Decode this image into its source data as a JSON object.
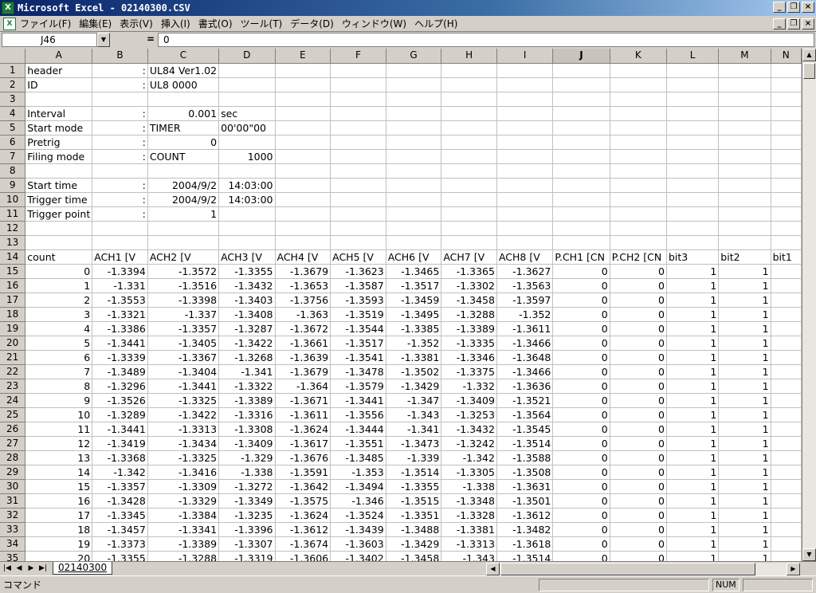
{
  "window": {
    "title": "Microsoft Excel - 02140300.CSV",
    "app_icon": "X",
    "min": "_",
    "restore": "❐",
    "close": "×"
  },
  "menu": [
    "ファイル(F)",
    "編集(E)",
    "表示(V)",
    "挿入(I)",
    "書式(O)",
    "ツール(T)",
    "データ(D)",
    "ウィンドウ(W)",
    "ヘルプ(H)"
  ],
  "formula": {
    "name_box": "J46",
    "equals": "=",
    "value": "0"
  },
  "columns": [
    "A",
    "B",
    "C",
    "D",
    "E",
    "F",
    "G",
    "H",
    "I",
    "J",
    "K",
    "L",
    "M",
    "N"
  ],
  "selected_column": "J",
  "rows": [
    [
      "1",
      "header",
      ":",
      "UL84  Ver1.02",
      "",
      "",
      "",
      "",
      "",
      "",
      "",
      "",
      "",
      "",
      ""
    ],
    [
      "2",
      "ID",
      ":",
      "UL8 0000",
      "",
      "",
      "",
      "",
      "",
      "",
      "",
      "",
      "",
      "",
      ""
    ],
    [
      "3",
      "",
      "",
      "",
      "",
      "",
      "",
      "",
      "",
      "",
      "",
      "",
      "",
      "",
      ""
    ],
    [
      "4",
      "Interval",
      ":",
      "0.001",
      "sec",
      "",
      "",
      "",
      "",
      "",
      "",
      "",
      "",
      "",
      ""
    ],
    [
      "5",
      "Start mode",
      ":",
      "TIMER",
      "00'00\"00",
      "",
      "",
      "",
      "",
      "",
      "",
      "",
      "",
      "",
      ""
    ],
    [
      "6",
      "Pretrig",
      ":",
      "0",
      "",
      "",
      "",
      "",
      "",
      "",
      "",
      "",
      "",
      "",
      ""
    ],
    [
      "7",
      "Filing mode",
      ":",
      "COUNT",
      "1000",
      "",
      "",
      "",
      "",
      "",
      "",
      "",
      "",
      "",
      ""
    ],
    [
      "8",
      "",
      "",
      "",
      "",
      "",
      "",
      "",
      "",
      "",
      "",
      "",
      "",
      "",
      ""
    ],
    [
      "9",
      "Start time",
      ":",
      "2004/9/2",
      "14:03:00",
      "",
      "",
      "",
      "",
      "",
      "",
      "",
      "",
      "",
      ""
    ],
    [
      "10",
      "Trigger time",
      ":",
      "2004/9/2",
      "14:03:00",
      "",
      "",
      "",
      "",
      "",
      "",
      "",
      "",
      "",
      ""
    ],
    [
      "11",
      "Trigger point",
      ":",
      "1",
      "",
      "",
      "",
      "",
      "",
      "",
      "",
      "",
      "",
      "",
      ""
    ],
    [
      "12",
      "",
      "",
      "",
      "",
      "",
      "",
      "",
      "",
      "",
      "",
      "",
      "",
      "",
      ""
    ],
    [
      "13",
      "",
      "",
      "",
      "",
      "",
      "",
      "",
      "",
      "",
      "",
      "",
      "",
      "",
      ""
    ],
    [
      "14",
      "count",
      "ACH1 [V",
      "ACH2 [V",
      "ACH3 [V",
      "ACH4 [V",
      "ACH5 [V",
      "ACH6 [V",
      "ACH7 [V",
      "ACH8 [V",
      "P.CH1 [CN",
      "P.CH2 [CN",
      "bit3",
      "bit2",
      "bit1"
    ],
    [
      "15",
      "0",
      "-1.3394",
      "-1.3572",
      "-1.3355",
      "-1.3679",
      "-1.3623",
      "-1.3465",
      "-1.3365",
      "-1.3627",
      "0",
      "0",
      "1",
      "1",
      ""
    ],
    [
      "16",
      "1",
      "-1.331",
      "-1.3516",
      "-1.3432",
      "-1.3653",
      "-1.3587",
      "-1.3517",
      "-1.3302",
      "-1.3563",
      "0",
      "0",
      "1",
      "1",
      ""
    ],
    [
      "17",
      "2",
      "-1.3553",
      "-1.3398",
      "-1.3403",
      "-1.3756",
      "-1.3593",
      "-1.3459",
      "-1.3458",
      "-1.3597",
      "0",
      "0",
      "1",
      "1",
      ""
    ],
    [
      "18",
      "3",
      "-1.3321",
      "-1.337",
      "-1.3408",
      "-1.363",
      "-1.3519",
      "-1.3495",
      "-1.3288",
      "-1.352",
      "0",
      "0",
      "1",
      "1",
      ""
    ],
    [
      "19",
      "4",
      "-1.3386",
      "-1.3357",
      "-1.3287",
      "-1.3672",
      "-1.3544",
      "-1.3385",
      "-1.3389",
      "-1.3611",
      "0",
      "0",
      "1",
      "1",
      ""
    ],
    [
      "20",
      "5",
      "-1.3441",
      "-1.3405",
      "-1.3422",
      "-1.3661",
      "-1.3517",
      "-1.352",
      "-1.3335",
      "-1.3466",
      "0",
      "0",
      "1",
      "1",
      ""
    ],
    [
      "21",
      "6",
      "-1.3339",
      "-1.3367",
      "-1.3268",
      "-1.3639",
      "-1.3541",
      "-1.3381",
      "-1.3346",
      "-1.3648",
      "0",
      "0",
      "1",
      "1",
      ""
    ],
    [
      "22",
      "7",
      "-1.3489",
      "-1.3404",
      "-1.341",
      "-1.3679",
      "-1.3478",
      "-1.3502",
      "-1.3375",
      "-1.3466",
      "0",
      "0",
      "1",
      "1",
      ""
    ],
    [
      "23",
      "8",
      "-1.3296",
      "-1.3441",
      "-1.3322",
      "-1.364",
      "-1.3579",
      "-1.3429",
      "-1.332",
      "-1.3636",
      "0",
      "0",
      "1",
      "1",
      ""
    ],
    [
      "24",
      "9",
      "-1.3526",
      "-1.3325",
      "-1.3389",
      "-1.3671",
      "-1.3441",
      "-1.347",
      "-1.3409",
      "-1.3521",
      "0",
      "0",
      "1",
      "1",
      ""
    ],
    [
      "25",
      "10",
      "-1.3289",
      "-1.3422",
      "-1.3316",
      "-1.3611",
      "-1.3556",
      "-1.343",
      "-1.3253",
      "-1.3564",
      "0",
      "0",
      "1",
      "1",
      ""
    ],
    [
      "26",
      "11",
      "-1.3441",
      "-1.3313",
      "-1.3308",
      "-1.3624",
      "-1.3444",
      "-1.341",
      "-1.3432",
      "-1.3545",
      "0",
      "0",
      "1",
      "1",
      ""
    ],
    [
      "27",
      "12",
      "-1.3419",
      "-1.3434",
      "-1.3409",
      "-1.3617",
      "-1.3551",
      "-1.3473",
      "-1.3242",
      "-1.3514",
      "0",
      "0",
      "1",
      "1",
      ""
    ],
    [
      "28",
      "13",
      "-1.3368",
      "-1.3325",
      "-1.329",
      "-1.3676",
      "-1.3485",
      "-1.339",
      "-1.342",
      "-1.3588",
      "0",
      "0",
      "1",
      "1",
      ""
    ],
    [
      "29",
      "14",
      "-1.342",
      "-1.3416",
      "-1.338",
      "-1.3591",
      "-1.353",
      "-1.3514",
      "-1.3305",
      "-1.3508",
      "0",
      "0",
      "1",
      "1",
      ""
    ],
    [
      "30",
      "15",
      "-1.3357",
      "-1.3309",
      "-1.3272",
      "-1.3642",
      "-1.3494",
      "-1.3355",
      "-1.338",
      "-1.3631",
      "0",
      "0",
      "1",
      "1",
      ""
    ],
    [
      "31",
      "16",
      "-1.3428",
      "-1.3329",
      "-1.3349",
      "-1.3575",
      "-1.346",
      "-1.3515",
      "-1.3348",
      "-1.3501",
      "0",
      "0",
      "1",
      "1",
      ""
    ],
    [
      "32",
      "17",
      "-1.3345",
      "-1.3384",
      "-1.3235",
      "-1.3624",
      "-1.3524",
      "-1.3351",
      "-1.3328",
      "-1.3612",
      "0",
      "0",
      "1",
      "1",
      ""
    ],
    [
      "33",
      "18",
      "-1.3457",
      "-1.3341",
      "-1.3396",
      "-1.3612",
      "-1.3439",
      "-1.3488",
      "-1.3381",
      "-1.3482",
      "0",
      "0",
      "1",
      "1",
      ""
    ],
    [
      "34",
      "19",
      "-1.3373",
      "-1.3389",
      "-1.3307",
      "-1.3674",
      "-1.3603",
      "-1.3429",
      "-1.3313",
      "-1.3618",
      "0",
      "0",
      "1",
      "1",
      ""
    ],
    [
      "35",
      "20",
      "-1.3355",
      "-1.3288",
      "-1.3319",
      "-1.3606",
      "-1.3402",
      "-1.3458",
      "-1.343",
      "-1.3514",
      "0",
      "0",
      "1",
      "1",
      ""
    ]
  ],
  "sheet_tab": "02140300",
  "tab_nav": [
    "|◀",
    "◀",
    "▶",
    "▶|"
  ],
  "status": {
    "mode": "コマンド",
    "num": "NUM"
  }
}
